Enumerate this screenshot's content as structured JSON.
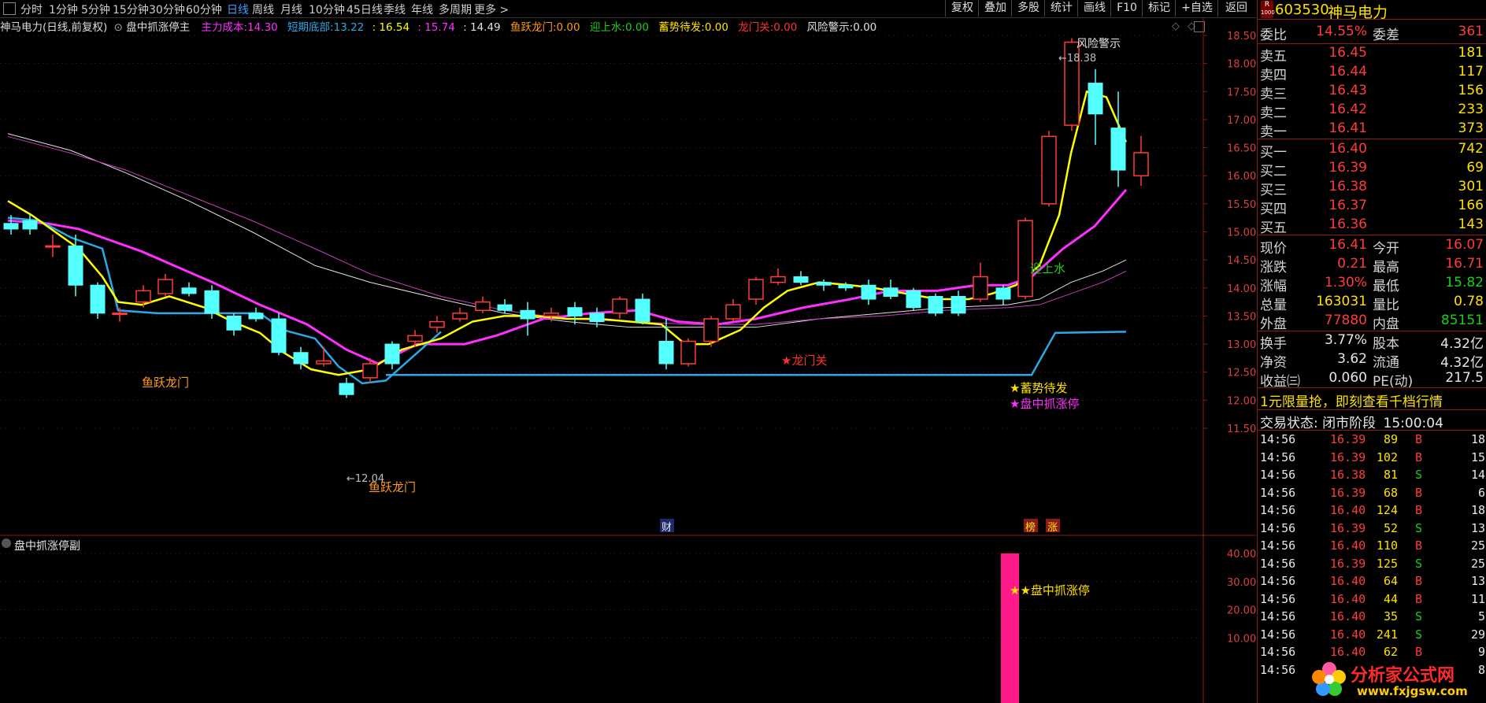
{
  "toolbar": {
    "periods": [
      "分时",
      "1分钟",
      "5分钟",
      "15分钟",
      "30分钟",
      "60分钟",
      "日线",
      "周线",
      "月线",
      "10分钟",
      "45日线",
      "季线",
      "年线",
      "多周期",
      "更多 >"
    ],
    "active_period": "日线",
    "buttons": [
      "复权",
      "叠加",
      "多股",
      "统计",
      "画线",
      "F10",
      "标记",
      "+自选",
      "返回"
    ]
  },
  "header": {
    "title": "神马电力(日线,前复权)",
    "indicator_name": "盘中抓涨停主",
    "zlcb_label": "主力成本:",
    "zlcb_value": "14.30",
    "dqdb_label": "短期底部:",
    "dqdb_value": "13.22",
    "v3": ": 16.54",
    "v4": ": 15.74",
    "v5": ": 14.49",
    "yylm_label": "鱼跃龙门:",
    "yylm_value": "0.00",
    "ysy_label": "迎上水:",
    "ysy_value": "0.00",
    "xsdf_label": "蓄势待发:",
    "xsdf_value": "0.00",
    "lmg_label": "龙门关:",
    "lmg_value": "0.00",
    "fxjs_label": "风险警示:",
    "fxjs_value": "0.00"
  },
  "main_chart": {
    "y_ticks": [
      "18.50",
      "18.00",
      "17.50",
      "17.00",
      "16.50",
      "16.00",
      "15.50",
      "15.00",
      "14.50",
      "14.00",
      "13.50",
      "13.00",
      "12.50",
      "12.00",
      "11.50"
    ],
    "annotations": {
      "risk_warning": "风险警示",
      "high_mark": "18.38",
      "low_mark": "12.04",
      "yuyue_1": "鱼跃龙门",
      "yuyue_2": "鱼跃龙门",
      "longmen": "★龙门关",
      "yingshangshui": "迎上水",
      "xushi": "★蓄势待发",
      "panzhong": "★盘中抓涨停",
      "cai": "财",
      "bang": "榜",
      "zhang": "涨"
    }
  },
  "sub_chart": {
    "title": "盘中抓涨停副",
    "y_ticks": [
      "40.00",
      "30.00",
      "20.00",
      "10.00"
    ],
    "label": "★盘中抓涨停",
    "bar_value": 40
  },
  "quote": {
    "code": "603530",
    "name": "神马电力",
    "badge_r": "R",
    "badge_num": "1000",
    "weibi_label": "委比",
    "weibi": "14.55%",
    "weicha_label": "委差",
    "weicha": "361",
    "asks": [
      {
        "label": "卖五",
        "price": "16.45",
        "vol": "181"
      },
      {
        "label": "卖四",
        "price": "16.44",
        "vol": "117"
      },
      {
        "label": "卖三",
        "price": "16.43",
        "vol": "156"
      },
      {
        "label": "卖二",
        "price": "16.42",
        "vol": "233"
      },
      {
        "label": "卖一",
        "price": "16.41",
        "vol": "373"
      }
    ],
    "bids": [
      {
        "label": "买一",
        "price": "16.40",
        "vol": "742"
      },
      {
        "label": "买二",
        "price": "16.39",
        "vol": "69"
      },
      {
        "label": "买三",
        "price": "16.38",
        "vol": "301"
      },
      {
        "label": "买四",
        "price": "16.37",
        "vol": "166"
      },
      {
        "label": "买五",
        "price": "16.36",
        "vol": "143"
      }
    ],
    "stats": [
      {
        "l1": "现价",
        "v1": "16.41",
        "c1": "red",
        "l2": "今开",
        "v2": "16.07",
        "c2": "red"
      },
      {
        "l1": "涨跌",
        "v1": "0.21",
        "c1": "red",
        "l2": "最高",
        "v2": "16.71",
        "c2": "red"
      },
      {
        "l1": "涨幅",
        "v1": "1.30%",
        "c1": "red",
        "l2": "最低",
        "v2": "15.82",
        "c2": "grn"
      },
      {
        "l1": "总量",
        "v1": "163031",
        "c1": "yel",
        "l2": "量比",
        "v2": "0.78",
        "c2": "yel"
      },
      {
        "l1": "外盘",
        "v1": "77880",
        "c1": "red",
        "l2": "内盘",
        "v2": "85151",
        "c2": "grn"
      }
    ],
    "stats2": [
      {
        "l1": "换手",
        "v1": "3.77%",
        "l2": "股本",
        "v2": "4.32亿"
      },
      {
        "l1": "净资",
        "v1": "3.62",
        "l2": "流通",
        "v2": "4.32亿"
      },
      {
        "l1": "收益㈢",
        "v1": "0.060",
        "l2": "PE(动)",
        "v2": "217.5"
      }
    ],
    "promo": "1元限量抢，即刻查看千档行情",
    "trade_status_label": "交易状态:",
    "trade_status": "闭市阶段",
    "trade_time": "15:00:04",
    "ticks": [
      {
        "t": "14:56",
        "p": "16.39",
        "v": "89",
        "s": "B",
        "n": "18"
      },
      {
        "t": "14:56",
        "p": "16.39",
        "v": "102",
        "s": "B",
        "n": "15"
      },
      {
        "t": "14:56",
        "p": "16.38",
        "v": "81",
        "s": "S",
        "n": "14"
      },
      {
        "t": "14:56",
        "p": "16.39",
        "v": "68",
        "s": "B",
        "n": "6"
      },
      {
        "t": "14:56",
        "p": "16.40",
        "v": "124",
        "s": "B",
        "n": "18"
      },
      {
        "t": "14:56",
        "p": "16.39",
        "v": "52",
        "s": "S",
        "n": "13"
      },
      {
        "t": "14:56",
        "p": "16.40",
        "v": "110",
        "s": "B",
        "n": "25"
      },
      {
        "t": "14:56",
        "p": "16.39",
        "v": "125",
        "s": "S",
        "n": "25"
      },
      {
        "t": "14:56",
        "p": "16.40",
        "v": "64",
        "s": "B",
        "n": "13"
      },
      {
        "t": "14:56",
        "p": "16.40",
        "v": "44",
        "s": "B",
        "n": "11"
      },
      {
        "t": "14:56",
        "p": "16.40",
        "v": "35",
        "s": "S",
        "n": "5"
      },
      {
        "t": "14:56",
        "p": "16.40",
        "v": "241",
        "s": "S",
        "n": "29"
      },
      {
        "t": "14:56",
        "p": "16.40",
        "v": "62",
        "s": "B",
        "n": "9"
      },
      {
        "t": "14:56",
        "p": "",
        "v": "",
        "s": "",
        "n": "8"
      }
    ],
    "watermark": "分析家公式网",
    "watermark_url": "www.fxjgsw.com"
  },
  "colors": {
    "up": "#ff3b3b",
    "down": "#54ffff",
    "ma_yellow": "#ffff00",
    "ma_magenta": "#ff2fff",
    "ma_white": "#e0e0e0",
    "ma_purple": "#c040c0",
    "cyan_line": "#2aa8e8",
    "accent_blue": "#3aa0ff"
  }
}
